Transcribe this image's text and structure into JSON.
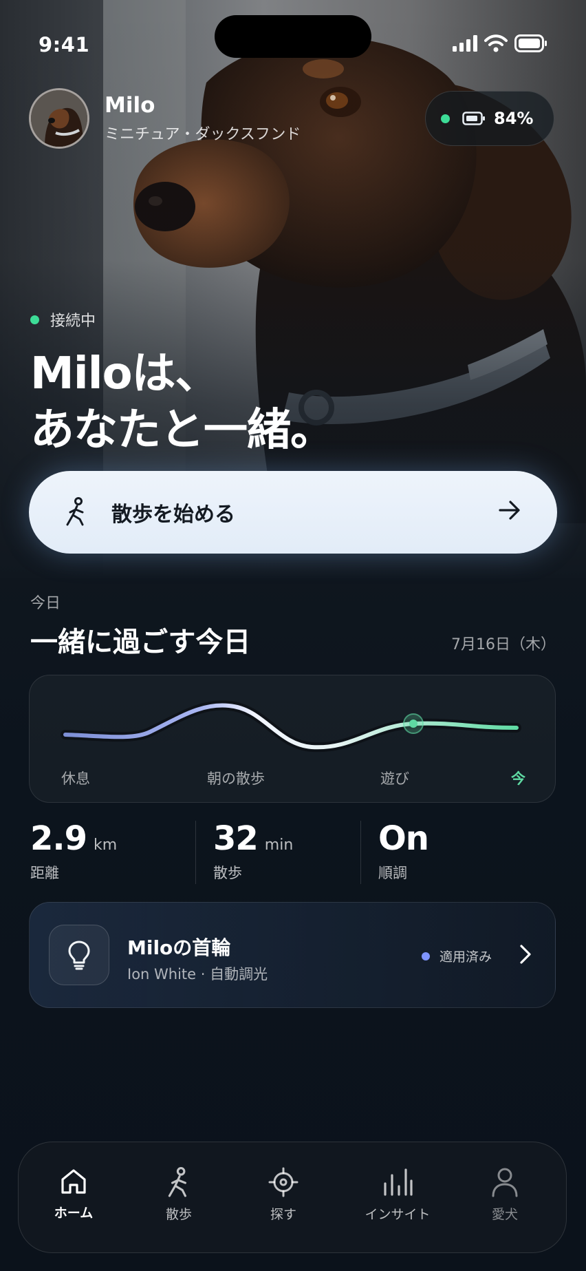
{
  "status_bar": {
    "time": "9:41"
  },
  "profile": {
    "name": "Milo",
    "breed": "ミニチュア・ダックスフンド"
  },
  "battery": {
    "percent": "84%"
  },
  "connection": {
    "status": "接続中"
  },
  "headline": {
    "line1": "Miloは、",
    "line2": "あなたと一緒。"
  },
  "cta": {
    "label": "散歩を始める",
    "icon": "walking-person-icon"
  },
  "today": {
    "kicker": "今日",
    "title": "一緒に過ごす今日",
    "date": "7月16日（木）",
    "timeline": [
      {
        "label": "休息"
      },
      {
        "label": "朝の散歩"
      },
      {
        "label": "遊び"
      },
      {
        "label": "今"
      }
    ]
  },
  "stats": [
    {
      "value": "2.9",
      "unit": "km",
      "label": "距離"
    },
    {
      "value": "32",
      "unit": "min",
      "label": "散歩"
    },
    {
      "value": "On",
      "unit": "",
      "label": "順調"
    }
  ],
  "collar": {
    "title": "Miloの首輪",
    "subtitle": "Ion White · 自動調光",
    "status": "適用済み"
  },
  "tabs": [
    {
      "label": "ホーム",
      "icon": "home-icon",
      "active": true
    },
    {
      "label": "散歩",
      "icon": "walk-icon",
      "active": false
    },
    {
      "label": "探す",
      "icon": "locate-icon",
      "active": false
    },
    {
      "label": "インサイト",
      "icon": "insights-icon",
      "active": false
    },
    {
      "label": "愛犬",
      "icon": "profile-icon",
      "active": false
    }
  ],
  "colors": {
    "accent_green": "#3ddc97",
    "accent_blue": "#7f95ff",
    "cta_bg": "#eef4fb"
  }
}
